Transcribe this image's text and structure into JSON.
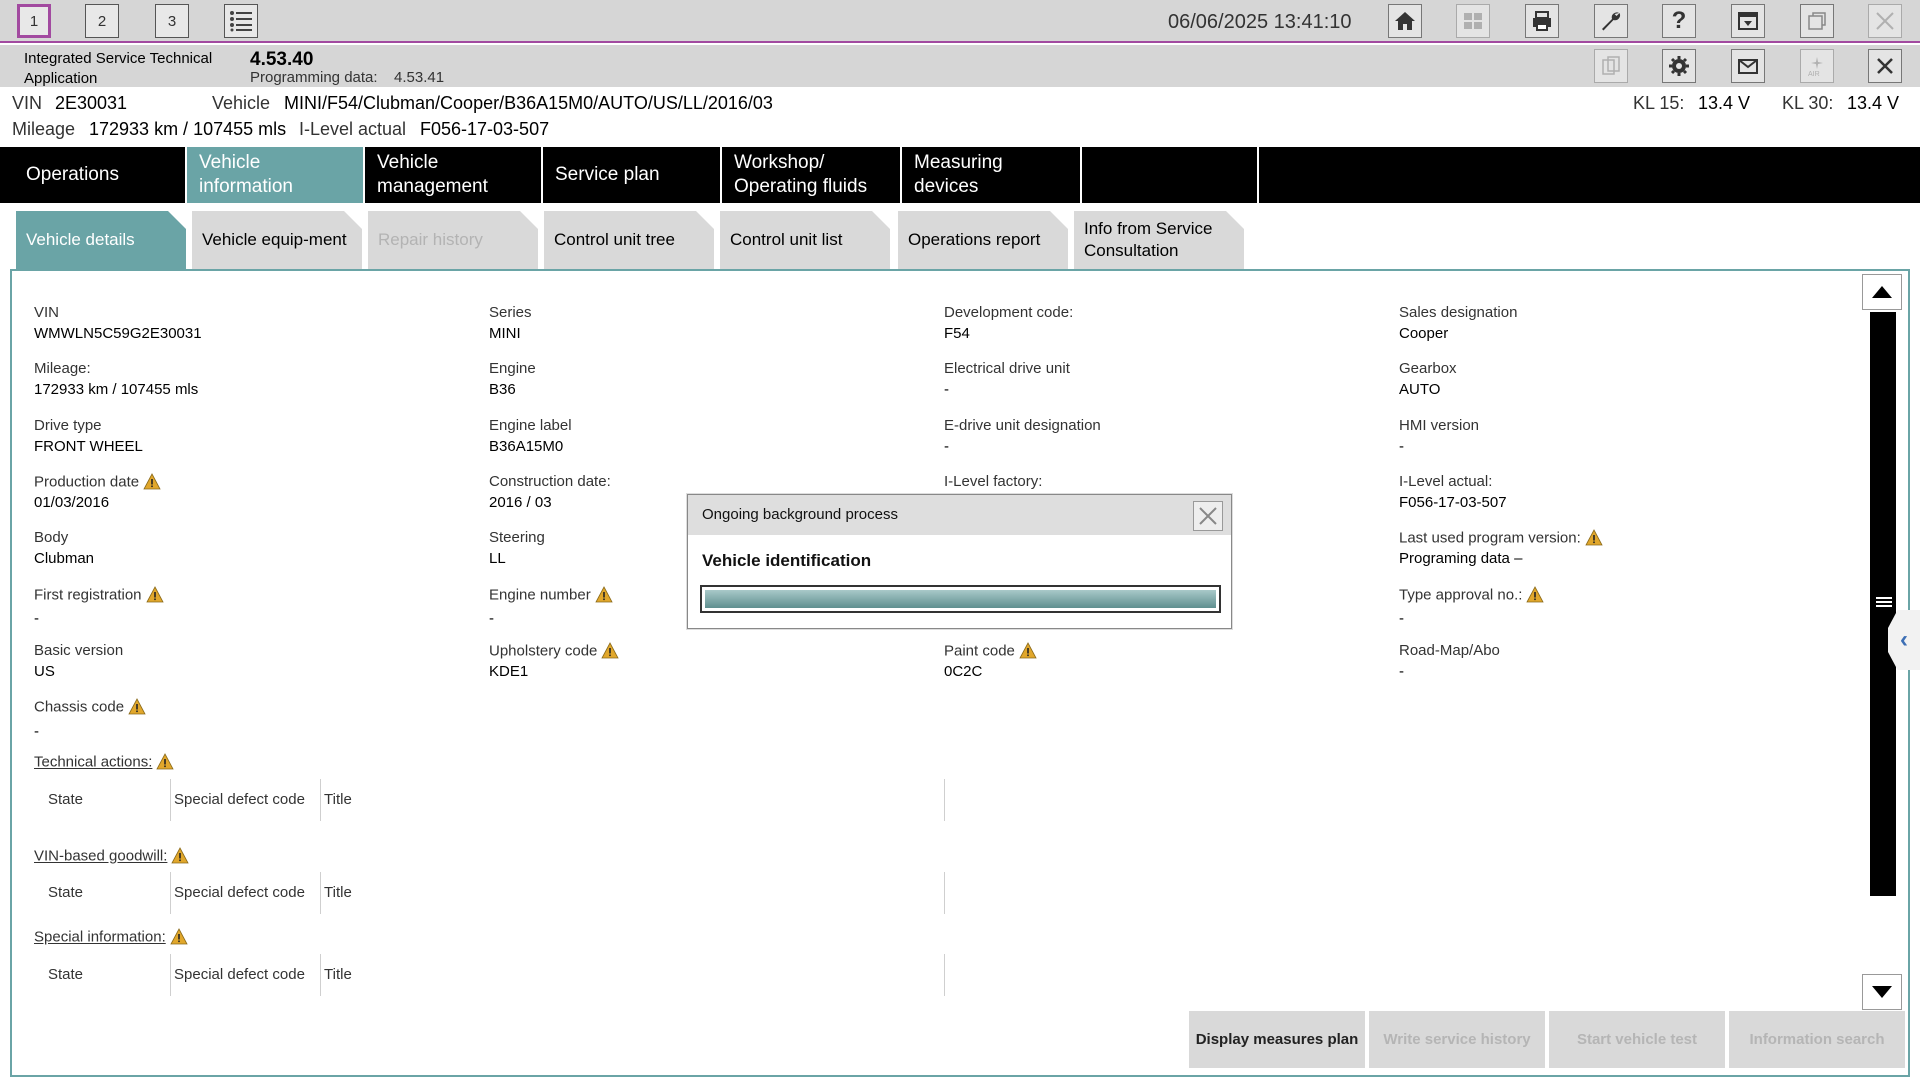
{
  "toolbar": {
    "window_tabs": [
      "1",
      "2",
      "3"
    ],
    "datetime": "06/06/2025 13:41:10"
  },
  "app": {
    "name": "Integrated Service Technical Application",
    "version": "4.53.40",
    "programming_label": "Programming data:",
    "programming_value": "4.53.41"
  },
  "vehicle_bar": {
    "vin_label": "VIN",
    "vin_value": "2E30031",
    "vehicle_label": "Vehicle",
    "vehicle_value": "MINI/F54/Clubman/Cooper/B36A15M0/AUTO/US/LL/2016/03",
    "mileage_label": "Mileage",
    "mileage_value": "172933 km / 107455 mls",
    "ilevel_label": "I-Level actual",
    "ilevel_value": "F056-17-03-507",
    "kl15_label": "KL 15:",
    "kl15_value": "13.4 V",
    "kl30_label": "KL 30:",
    "kl30_value": "13.4 V"
  },
  "main_nav": {
    "items": [
      {
        "label": "Operations"
      },
      {
        "label": "Vehicle information"
      },
      {
        "label": "Vehicle management"
      },
      {
        "label": "Service plan"
      },
      {
        "label": "Workshop/ Operating fluids"
      },
      {
        "label": "Measuring devices"
      },
      {
        "label": ""
      }
    ]
  },
  "sub_tabs": {
    "items": [
      {
        "label": "Vehicle details"
      },
      {
        "label": "Vehicle equip-ment"
      },
      {
        "label": "Repair history"
      },
      {
        "label": "Control unit tree"
      },
      {
        "label": "Control unit list"
      },
      {
        "label": "Operations report"
      },
      {
        "label": "Info from Service Consultation"
      }
    ]
  },
  "details": {
    "col1": [
      {
        "label": "VIN",
        "value": "WMWLN5C59G2E30031"
      },
      {
        "label": "Mileage:",
        "value": "172933 km / 107455 mls"
      },
      {
        "label": "Drive type",
        "value": "FRONT WHEEL"
      },
      {
        "label": "Production date",
        "value": "01/03/2016"
      },
      {
        "label": "Body",
        "value": "Clubman"
      },
      {
        "label": "First registration",
        "value": "-"
      },
      {
        "label": "Basic version",
        "value": "US"
      },
      {
        "label": "Chassis code",
        "value": "-"
      }
    ],
    "col2": [
      {
        "label": "Series",
        "value": "MINI"
      },
      {
        "label": "Engine",
        "value": "B36"
      },
      {
        "label": "Engine label",
        "value": "B36A15M0"
      },
      {
        "label": "Construction date:",
        "value": "2016 / 03"
      },
      {
        "label": "Steering",
        "value": "LL"
      },
      {
        "label": "Engine number",
        "value": "-"
      },
      {
        "label": "Upholstery code",
        "value": "KDE1"
      }
    ],
    "col3": [
      {
        "label": "Development code:",
        "value": "F54"
      },
      {
        "label": "Electrical drive unit",
        "value": "-"
      },
      {
        "label": "E-drive unit designation",
        "value": "-"
      },
      {
        "label": "I-Level factory:",
        "value": ""
      },
      {
        "label": "Paint code",
        "value": "0C2C"
      }
    ],
    "col4": [
      {
        "label": "Sales designation",
        "value": "Cooper"
      },
      {
        "label": "Gearbox",
        "value": "AUTO"
      },
      {
        "label": "HMI version",
        "value": "-"
      },
      {
        "label": "I-Level actual:",
        "value": "F056-17-03-507"
      },
      {
        "label": "Last used program version:",
        "value": "Programing data –"
      },
      {
        "label": "Type approval no.:",
        "value": "-"
      },
      {
        "label": "Road-Map/Abo",
        "value": "-"
      }
    ]
  },
  "sections": [
    {
      "title": "Technical actions:",
      "headers": [
        "State",
        "Special defect code",
        "Title"
      ]
    },
    {
      "title": "VIN-based goodwill:",
      "headers": [
        "State",
        "Special defect code",
        "Title"
      ]
    },
    {
      "title": "Special information:",
      "headers": [
        "State",
        "Special defect code",
        "Title"
      ]
    }
  ],
  "actions": {
    "display_measures_plan": "Display measures plan",
    "write_service_history": "Write service history",
    "start_vehicle_test": "Start vehicle test",
    "information_search": "Information search"
  },
  "dialog": {
    "title": "Ongoing background process",
    "message": "Vehicle identification",
    "progress": 1.0
  },
  "colors": {
    "accent_teal": "#6aa4a6",
    "active_tab_border": "#a24aa0",
    "warning": "#e1a72b"
  }
}
